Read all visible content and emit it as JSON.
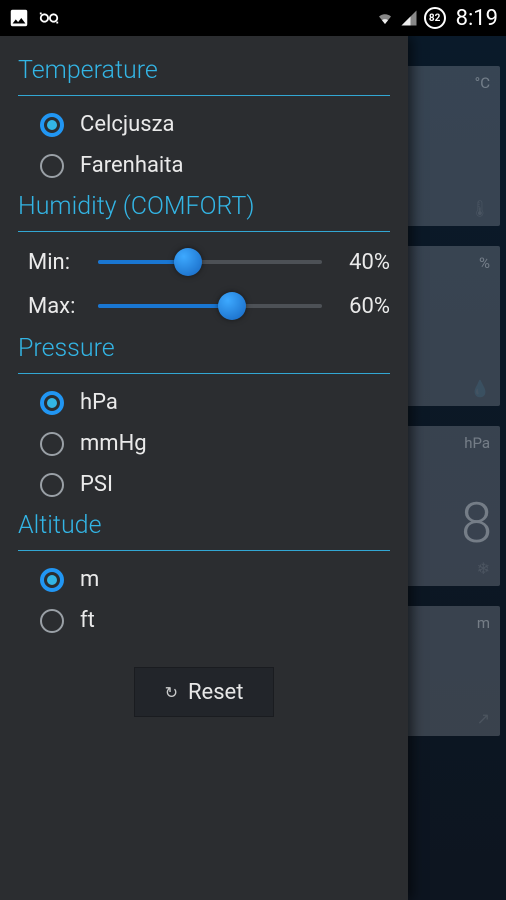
{
  "statusbar": {
    "clock": "8:19",
    "battery": "82"
  },
  "sections": {
    "temperature": {
      "title": "Temperature",
      "options": [
        "Celcjusza",
        "Farenhaita"
      ],
      "selected": 0
    },
    "humidity": {
      "title": "Humidity (COMFORT)",
      "min_label": "Min:",
      "max_label": "Max:",
      "min_value": "40%",
      "max_value": "60%",
      "min_pct": 40,
      "max_pct": 60
    },
    "pressure": {
      "title": "Pressure",
      "options": [
        "hPa",
        "mmHg",
        "PSI"
      ],
      "selected": 0
    },
    "altitude": {
      "title": "Altitude",
      "options": [
        "m",
        "ft"
      ],
      "selected": 0
    }
  },
  "reset_label": "Reset",
  "bg": {
    "card1": "°C",
    "card2": "%",
    "card3_unit": "hPa",
    "card3_val": "8",
    "card4": "m"
  }
}
